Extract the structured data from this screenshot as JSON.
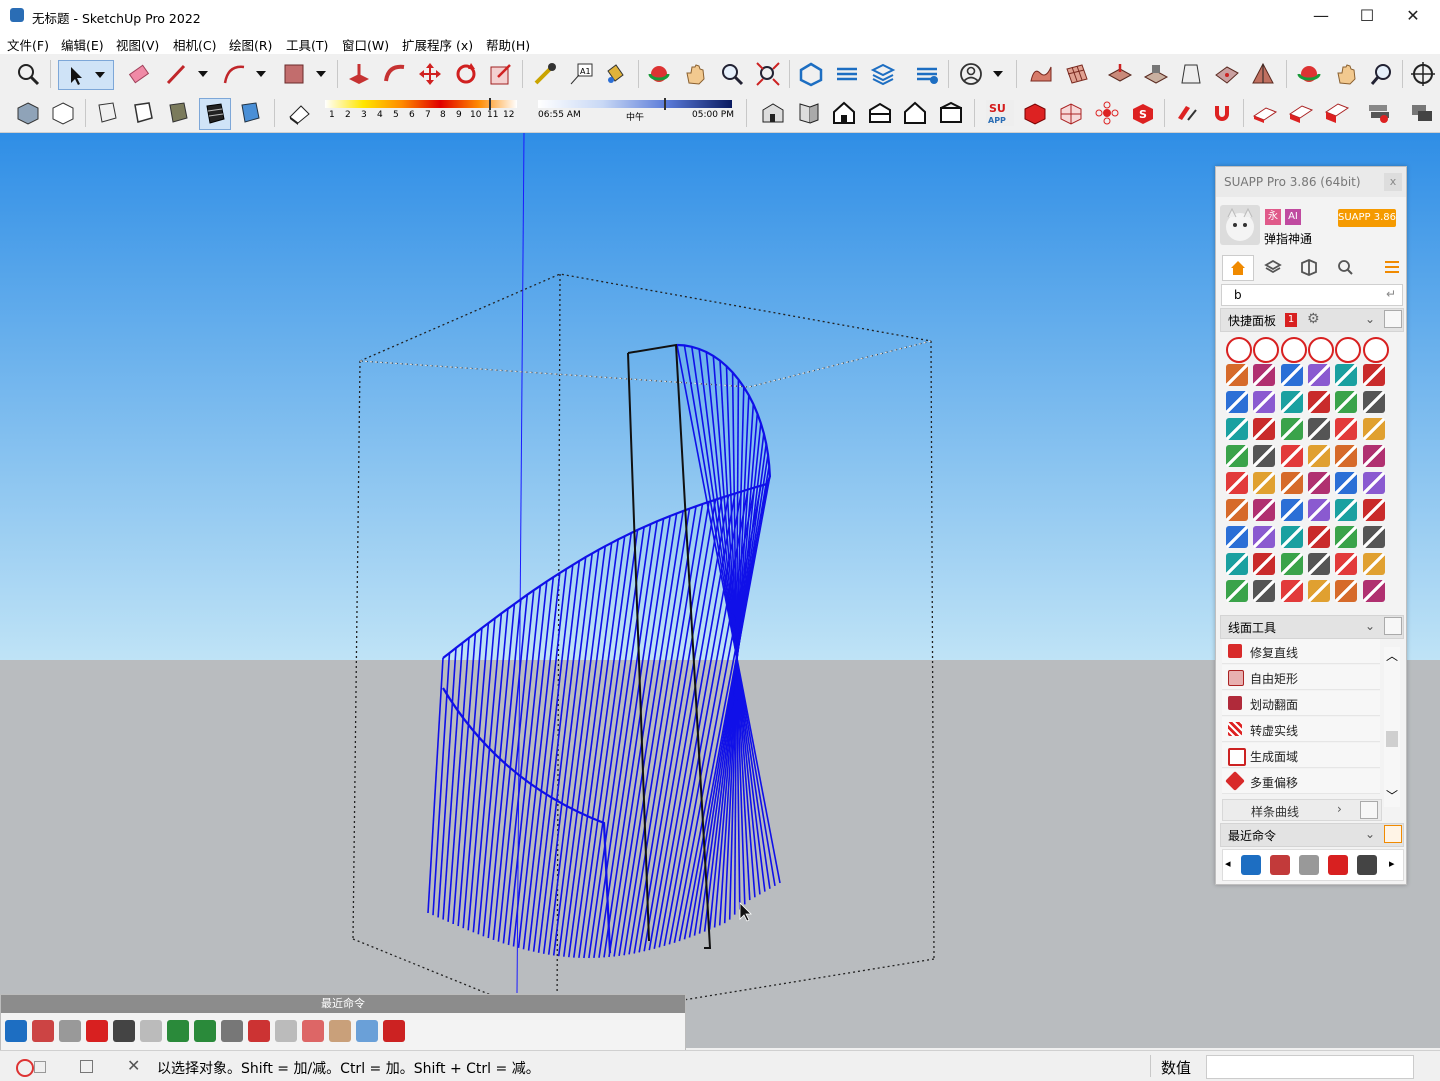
{
  "window": {
    "title": "无标题 - SketchUp Pro 2022",
    "minimize": "—",
    "maximize": "☐",
    "close": "✕"
  },
  "menu": [
    "文件(F)",
    "编辑(E)",
    "视图(V)",
    "相机(C)",
    "绘图(R)",
    "工具(T)",
    "窗口(W)",
    "扩展程序 (x)",
    "帮助(H)"
  ],
  "shadow_toolbar": {
    "months": [
      "1",
      "2",
      "3",
      "4",
      "5",
      "6",
      "7",
      "8",
      "9",
      "10",
      "11",
      "12"
    ],
    "time_start": "06:55 AM",
    "time_mid": "中午",
    "time_end": "05:00 PM"
  },
  "suapp": {
    "title": "SUAPP Pro 3.86 (64bit)",
    "close": "x",
    "badge": "SUAPP 3.86",
    "user_name": "弹指神通",
    "tag_a": "永",
    "tag_b": "AI",
    "search_value": "b",
    "quick_panel": {
      "label": "快捷面板",
      "count": "1"
    },
    "line_tools": {
      "label": "线面工具",
      "items": [
        "修复直线",
        "自由矩形",
        "划动翻面",
        "转虚实线",
        "生成面域",
        "多重偏移"
      ],
      "more": "样条曲线"
    },
    "recent": {
      "label": "最近命令"
    }
  },
  "recent_toolbar": {
    "title": "最近命令"
  },
  "status": {
    "hint": "以选择对象。Shift = 加/减。Ctrl = 加。Shift + Ctrl = 减。",
    "measure_label": "数值",
    "measure_value": ""
  },
  "colors": {
    "sky_top": "#2f8ee6",
    "sky_bottom": "#bfe3f6",
    "ground": "#b9bcbf",
    "geometry_blue": "#1010e8",
    "accent_orange": "#f59a00"
  }
}
